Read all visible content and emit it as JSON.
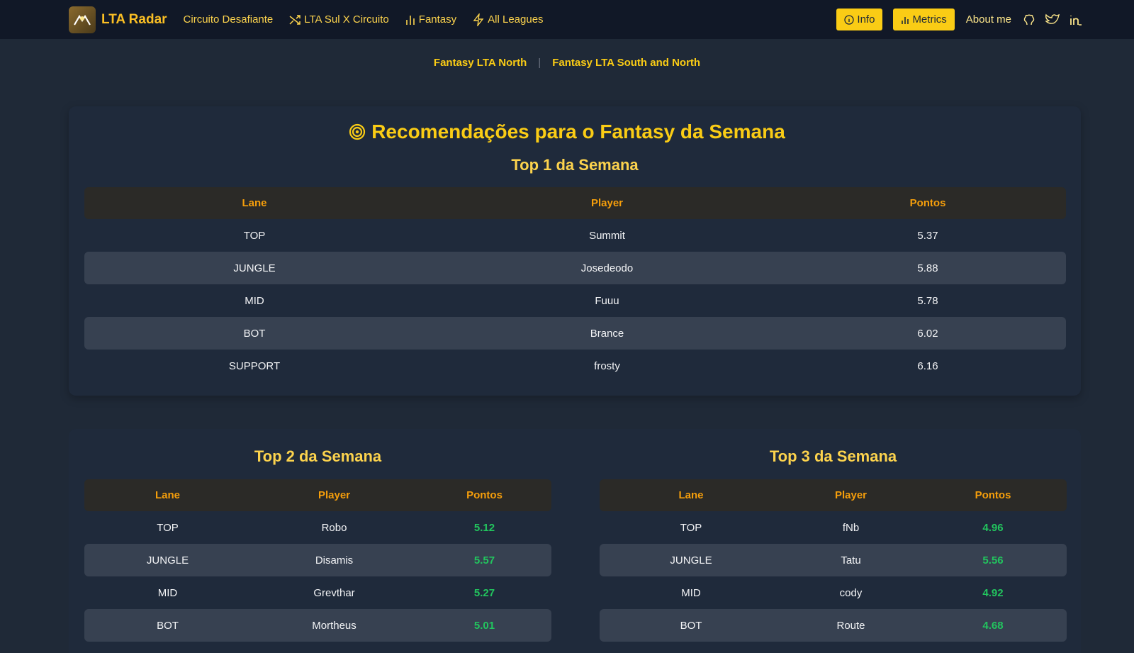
{
  "navbar": {
    "brand": "LTA Radar",
    "links": [
      {
        "label": "Circuito Desafiante",
        "icon": ""
      },
      {
        "label": "LTA Sul X Circuito",
        "icon": "shuffle-icon"
      },
      {
        "label": "Fantasy",
        "icon": "bar-chart-icon"
      },
      {
        "label": "All Leagues",
        "icon": "lightning-icon"
      }
    ],
    "info_label": "Info",
    "metrics_label": "Metrics",
    "about_label": "About me"
  },
  "subnav": {
    "link1": "Fantasy LTA North",
    "separator": "|",
    "link2": "Fantasy LTA South and North"
  },
  "main": {
    "title": "Recomendações para o Fantasy da Semana",
    "top1": {
      "title": "Top 1 da Semana",
      "headers": [
        "Lane",
        "Player",
        "Pontos"
      ],
      "rows": [
        [
          "TOP",
          "Summit",
          "5.37"
        ],
        [
          "JUNGLE",
          "Josedeodo",
          "5.88"
        ],
        [
          "MID",
          "Fuuu",
          "5.78"
        ],
        [
          "BOT",
          "Brance",
          "6.02"
        ],
        [
          "SUPPORT",
          "frosty",
          "6.16"
        ]
      ]
    },
    "top2": {
      "title": "Top 2 da Semana",
      "headers": [
        "Lane",
        "Player",
        "Pontos"
      ],
      "rows": [
        [
          "TOP",
          "Robo",
          "5.12"
        ],
        [
          "JUNGLE",
          "Disamis",
          "5.57"
        ],
        [
          "MID",
          "Grevthar",
          "5.27"
        ],
        [
          "BOT",
          "Mortheus",
          "5.01"
        ]
      ]
    },
    "top3": {
      "title": "Top 3 da Semana",
      "headers": [
        "Lane",
        "Player",
        "Pontos"
      ],
      "rows": [
        [
          "TOP",
          "fNb",
          "4.96"
        ],
        [
          "JUNGLE",
          "Tatu",
          "5.56"
        ],
        [
          "MID",
          "cody",
          "4.92"
        ],
        [
          "BOT",
          "Route",
          "4.68"
        ]
      ]
    }
  },
  "colors": {
    "accent": "#facc15",
    "positive": "#22c55e",
    "background": "#1f2937"
  }
}
